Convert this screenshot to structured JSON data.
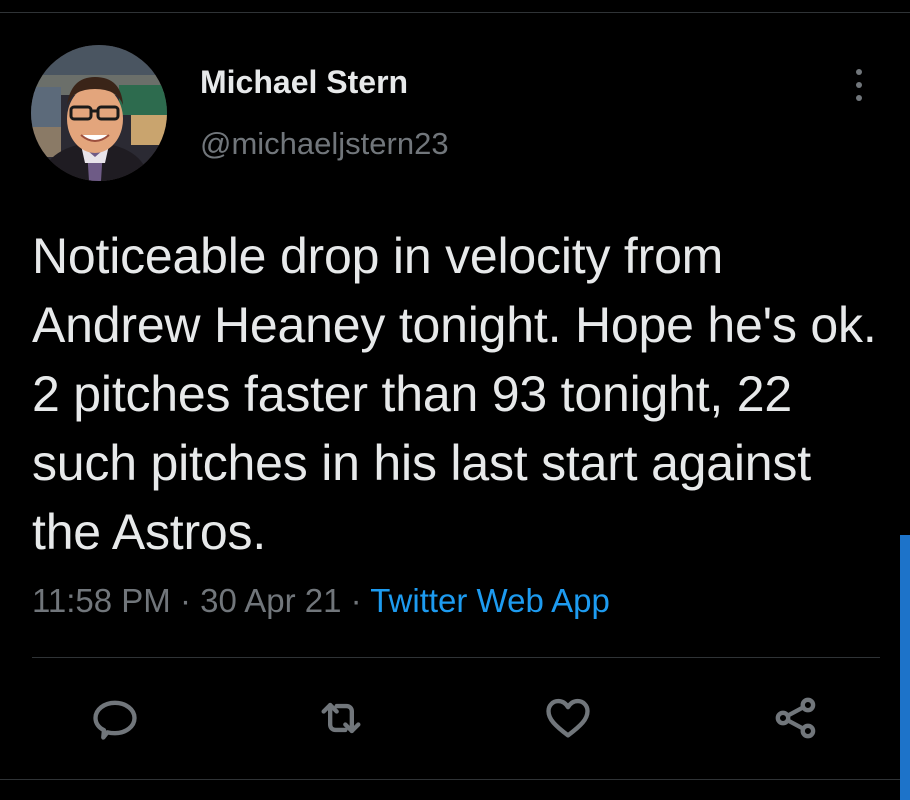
{
  "author": {
    "display_name": "Michael Stern",
    "handle": "@michaeljstern23"
  },
  "tweet": {
    "text": "Noticeable drop in velocity from Andrew Heaney tonight. Hope he's ok. 2 pitches faster than 93 tonight, 22 such pitches in his last start against the Astros.",
    "time": "11:58 PM",
    "separator": "·",
    "date": "30 Apr 21",
    "source": "Twitter Web App"
  },
  "icons": {
    "more": "more-vertical-icon",
    "reply": "reply-icon",
    "retweet": "retweet-icon",
    "like": "heart-icon",
    "share": "share-icon"
  },
  "colors": {
    "background": "#000000",
    "text": "#e7e9ea",
    "secondary": "#71767b",
    "link": "#1d9bf0",
    "divider": "#2f3336",
    "scrollbar": "#1d73c9"
  }
}
